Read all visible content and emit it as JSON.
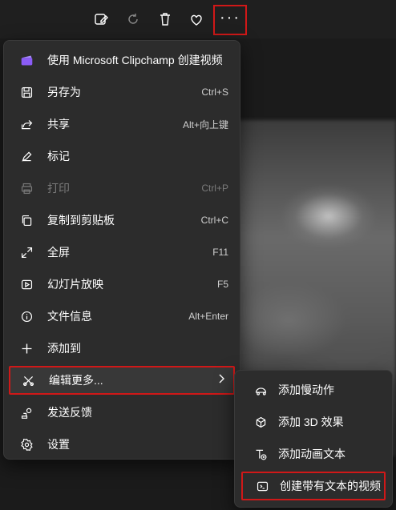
{
  "toolbar": {
    "icons": [
      "edit-image-icon",
      "rotate-icon",
      "delete-icon",
      "favorite-icon",
      "more-icon"
    ],
    "more_label": "···"
  },
  "menu": {
    "items": [
      {
        "label": "使用 Microsoft Clipchamp 创建视频",
        "shortcut": "",
        "icon": "clipchamp-icon"
      },
      {
        "label": "另存为",
        "shortcut": "Ctrl+S",
        "icon": "save-icon"
      },
      {
        "label": "共享",
        "shortcut": "Alt+向上键",
        "icon": "share-icon"
      },
      {
        "label": "标记",
        "shortcut": "",
        "icon": "markup-icon"
      },
      {
        "label": "打印",
        "shortcut": "Ctrl+P",
        "icon": "print-icon",
        "disabled": true
      },
      {
        "label": "复制到剪贴板",
        "shortcut": "Ctrl+C",
        "icon": "copy-icon"
      },
      {
        "label": "全屏",
        "shortcut": "F11",
        "icon": "fullscreen-icon"
      },
      {
        "label": "幻灯片放映",
        "shortcut": "F5",
        "icon": "slideshow-icon"
      },
      {
        "label": "文件信息",
        "shortcut": "Alt+Enter",
        "icon": "info-icon"
      },
      {
        "label": "添加到",
        "shortcut": "",
        "icon": "add-icon"
      },
      {
        "label": "编辑更多...",
        "shortcut": "",
        "icon": "edit-more-icon"
      },
      {
        "label": "发送反馈",
        "shortcut": "",
        "icon": "feedback-icon"
      },
      {
        "label": "设置",
        "shortcut": "",
        "icon": "settings-icon"
      }
    ]
  },
  "submenu": {
    "items": [
      {
        "label": "添加慢动作",
        "icon": "slow-motion-icon"
      },
      {
        "label": "添加 3D 效果",
        "icon": "effects-3d-icon"
      },
      {
        "label": "添加动画文本",
        "icon": "animated-text-icon"
      },
      {
        "label": "创建带有文本的视频",
        "icon": "video-text-icon"
      }
    ]
  },
  "colors": {
    "accent_red": "#d01818",
    "menu_bg": "#2c2c2c"
  }
}
